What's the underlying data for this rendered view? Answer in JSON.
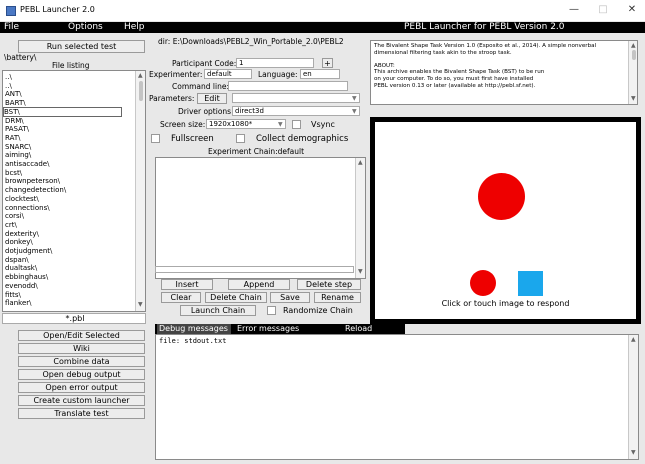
{
  "window": {
    "title": "PEBL Launcher 2.0"
  },
  "menu": {
    "file": "File",
    "options": "Options",
    "help": "Help",
    "banner": "PEBL Launcher for PEBL Version 2.0"
  },
  "left": {
    "run_selected": "Run selected test",
    "path": "\\battery\\",
    "file_listing": "File listing",
    "items": [
      "..\\",
      "..\\",
      "ANT\\",
      "BART\\",
      "BST\\",
      "DRM\\",
      "PASAT\\",
      "RAT\\",
      "SNARC\\",
      "aiming\\",
      "antisaccade\\",
      "bcst\\",
      "brownpeterson\\",
      "changedetection\\",
      "clocktest\\",
      "connections\\",
      "corsi\\",
      "crt\\",
      "dexterity\\",
      "donkey\\",
      "dotjudgment\\",
      "dspan\\",
      "dualtask\\",
      "ebbinghaus\\",
      "evenodd\\",
      "fitts\\",
      "flanker\\"
    ],
    "filter": "*.pbl",
    "buttons": [
      "Open/Edit Selected",
      "Wiki",
      "Combine data",
      "Open debug output",
      "Open error output",
      "Create custom launcher",
      "Translate test"
    ]
  },
  "center": {
    "dir": "dir: E:\\Downloads\\PEBL2_Win_Portable_2.0\\PEBL2",
    "participant_label": "Participant Code:",
    "participant_value": "1",
    "plus": "+",
    "experimenter_label": "Experimenter:",
    "experimenter_value": "default",
    "language_label": "Language:",
    "language_value": "en",
    "command_label": "Command line:",
    "command_value": "",
    "parameters_label": "Parameters:",
    "edit": "Edit",
    "driver_label": "Driver options",
    "driver_value": "direct3d",
    "screen_label": "Screen size:",
    "screen_value": "1920x1080*",
    "vsync": "Vsync",
    "fullscreen": "Fullscreen",
    "demographics": "Collect demographics",
    "chain_title": "Experiment Chain:default",
    "chain_buttons": {
      "insert": "Insert",
      "append": "Append",
      "delete_step": "Delete step",
      "clear": "Clear",
      "delete_chain": "Delete Chain",
      "save": "Save",
      "rename": "Rename",
      "launch_chain": "Launch Chain",
      "randomize_chain": "Randomize Chain"
    }
  },
  "right": {
    "description": [
      "The Bivalent Shape Task Version 1.0 (Esposito et al., 2014).  A simple nonverbal",
      "dimensional filtering task akin to the stroop task.",
      "",
      "ABOUT:",
      "This archive enables the Bivalent Shape Task (BST) to be run",
      "on your computer.  To do so, you must first have installed",
      "PEBL version 0.13 or later (available at http://pebl.sf.net)."
    ],
    "preview_caption": "Click or touch image to respond",
    "colors": {
      "red": "#ee0000",
      "blue": "#1aa7ec"
    }
  },
  "bottom": {
    "tabs": [
      "Debug messages",
      "Error messages",
      "Reload"
    ],
    "output": "file: stdout.txt"
  }
}
